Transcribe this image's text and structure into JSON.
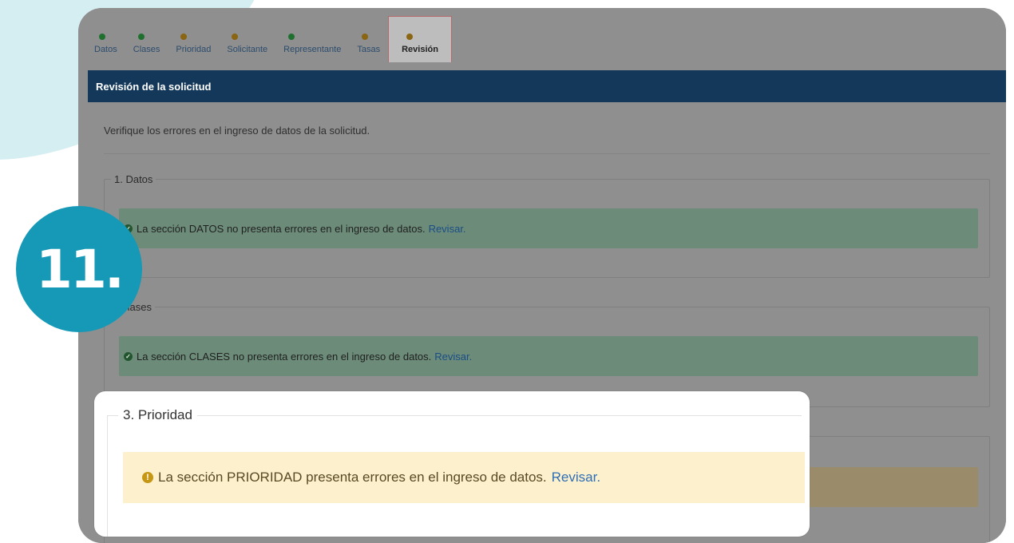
{
  "tabs": [
    {
      "label": "Datos",
      "status": "ok"
    },
    {
      "label": "Clases",
      "status": "ok"
    },
    {
      "label": "Prioridad",
      "status": "warn"
    },
    {
      "label": "Solicitante",
      "status": "warn"
    },
    {
      "label": "Representante",
      "status": "ok"
    },
    {
      "label": "Tasas",
      "status": "warn"
    },
    {
      "label": "Revisión",
      "status": "warn"
    }
  ],
  "panel": {
    "title": "Revisión de la solicitud",
    "intro": "Verifique los errores en el ingreso de datos de la solicitud."
  },
  "sections": [
    {
      "title": "1. Datos",
      "message": "La sección DATOS no presenta errores en el ingreso de datos.",
      "link": "Revisar.",
      "status": "ok"
    },
    {
      "title": ". Clases",
      "message": "La sección CLASES no presenta errores en el ingreso de datos.",
      "link": "Revisar.",
      "status": "ok"
    },
    {
      "title": "3. Prioridad",
      "message": "La sección PRIORIDAD presenta errores en el ingreso de datos.",
      "link": "Revisar.",
      "status": "warning"
    }
  ],
  "badge": {
    "text": "11."
  },
  "colors": {
    "header": "#13385a",
    "badge": "#1599b6",
    "ok_alert": "#6c8c79",
    "warning_alert": "#fcf0cd",
    "warning_icon": "#c59715",
    "link": "#2f6fb5"
  },
  "icons": {
    "ok": "check-circle-icon",
    "warning": "exclamation-circle-icon"
  }
}
